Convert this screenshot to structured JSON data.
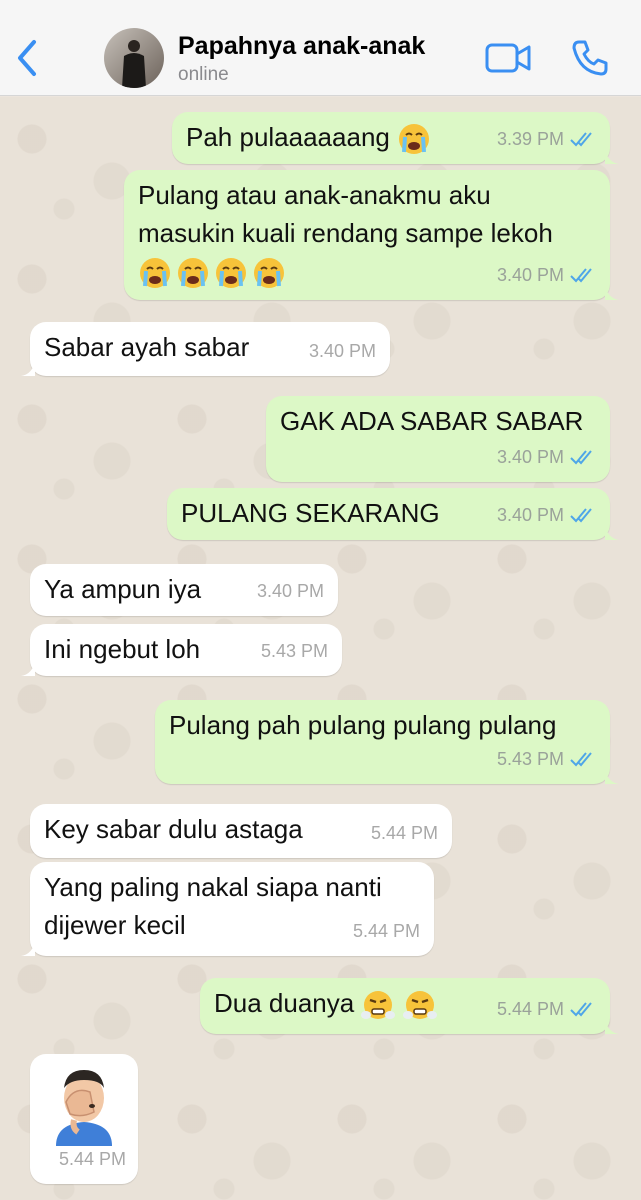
{
  "header": {
    "contact_name": "Papahnya anak-anak",
    "status": "online",
    "icons": [
      "back-chevron-icon",
      "video-call-icon",
      "phone-call-icon"
    ]
  },
  "colors": {
    "outgoing_bubble": "#dcf8c6",
    "incoming_bubble": "#ffffff",
    "accent": "#3a8ff2",
    "read_ticks": "#4fa6e8"
  },
  "messages": [
    {
      "dir": "out",
      "text": "Pah pulaaaaaang",
      "emoji": [
        "loudly-crying-face"
      ],
      "time": "3.39 PM",
      "read": true
    },
    {
      "dir": "out",
      "lines": [
        "Pulang atau anak-anakmu aku",
        "masukin kuali rendang sampe lekoh"
      ],
      "emoji": [
        "loudly-crying-face",
        "loudly-crying-face",
        "loudly-crying-face",
        "loudly-crying-face"
      ],
      "time": "3.40 PM",
      "read": true
    },
    {
      "dir": "in",
      "text": "Sabar ayah sabar",
      "time": "3.40 PM"
    },
    {
      "dir": "out",
      "text": "GAK ADA SABAR SABAR",
      "time": "3.40 PM",
      "read": true
    },
    {
      "dir": "out",
      "text": "PULANG SEKARANG",
      "time": "3.40 PM",
      "read": true
    },
    {
      "dir": "in",
      "text": "Ya ampun iya",
      "time": "3.40 PM"
    },
    {
      "dir": "in",
      "text": "Ini ngebut loh",
      "time": "5.43 PM"
    },
    {
      "dir": "out",
      "text": "Pulang pah pulang pulang pulang",
      "time": "5.43 PM",
      "read": true
    },
    {
      "dir": "in",
      "text": "Key sabar dulu astaga",
      "time": "5.44 PM"
    },
    {
      "dir": "in",
      "lines": [
        "Yang paling nakal siapa nanti",
        "dijewer kecil"
      ],
      "time": "5.44 PM"
    },
    {
      "dir": "out",
      "text": "Dua duanya",
      "emoji": [
        "face-with-steam-from-nose",
        "face-with-steam-from-nose"
      ],
      "time": "5.44 PM",
      "read": true
    },
    {
      "dir": "in",
      "sticker": "man-facepalming-memoji",
      "time": "5.44 PM"
    }
  ]
}
